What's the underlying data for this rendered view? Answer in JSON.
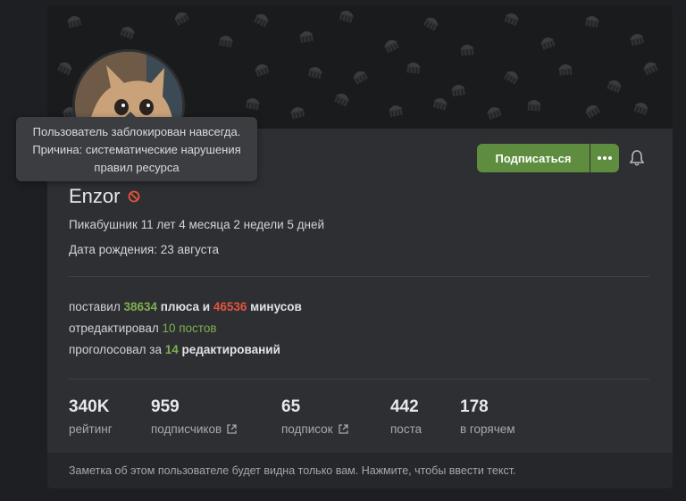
{
  "tooltip": {
    "line1": "Пользователь заблокирован навсегда.",
    "line2": "Причина: систематические нарушения",
    "line3": "правил ресурса"
  },
  "profile": {
    "username": "Enzor",
    "tenure": "Пикабушник 11 лет 4 месяца 2 недели 5 дней",
    "birthday": "Дата рождения: 23 августа",
    "ban_icon": "ban-icon",
    "avatar_description_icon": "cat-avatar"
  },
  "actions": {
    "subscribe_label": "Подписаться",
    "more_icon": "dots-icon",
    "bell_icon": "bell-icon",
    "accent_color": "#5e8d3f"
  },
  "activity": {
    "votes_prefix": "поставил ",
    "plus_count": "38634",
    "plus_label": " плюса",
    "and": " и ",
    "minus_count": "46536",
    "minus_label": " минусов",
    "edited_prefix": "отредактировал ",
    "edited_value": "10 постов",
    "voted_prefix": "проголосовал за ",
    "voted_count": "14",
    "voted_label": " редактирований"
  },
  "stats": [
    {
      "value": "340K",
      "label": "рейтинг"
    },
    {
      "value": "959",
      "label": "подписчиков"
    },
    {
      "value": "65",
      "label": "подписок"
    },
    {
      "value": "442",
      "label": "поста"
    },
    {
      "value": "178",
      "label": "в горячем"
    }
  ],
  "note": {
    "text": "Заметка об этом пользователе будет видна только вам. Нажмите, чтобы ввести текст."
  }
}
